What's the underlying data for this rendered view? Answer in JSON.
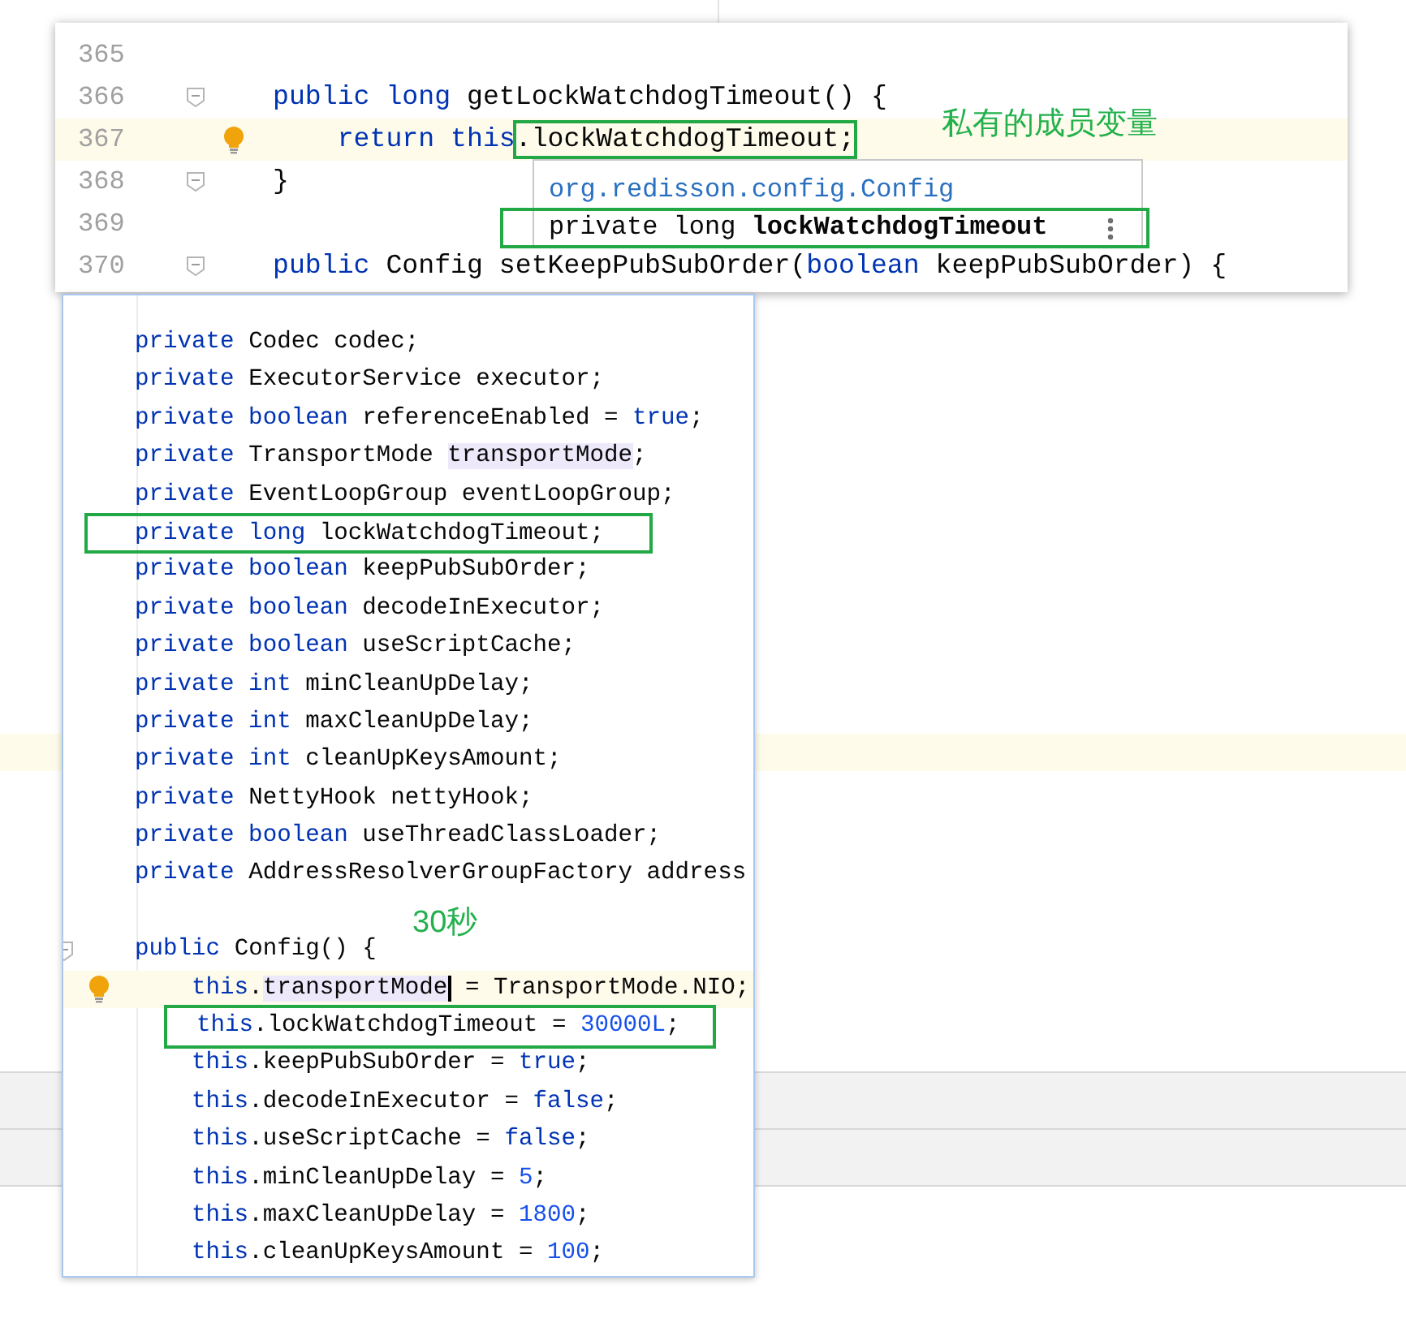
{
  "top_editor": {
    "lines": [
      {
        "number": "365",
        "fold": false,
        "bulb": false,
        "highlighted": false
      },
      {
        "number": "366",
        "fold": true,
        "bulb": false,
        "highlighted": false,
        "tokens": [
          {
            "text": "public long ",
            "kind": "kw"
          },
          {
            "text": "getLockWatchdogTimeout() {",
            "kind": "plain"
          }
        ]
      },
      {
        "number": "367",
        "fold": false,
        "bulb": true,
        "highlighted": true,
        "tokens": [
          {
            "text": "    return this",
            "kind": "kw"
          },
          {
            "text": ".lockWatchdogTimeout;",
            "kind": "plain",
            "boxed": true
          }
        ]
      },
      {
        "number": "368",
        "fold": true,
        "bulb": false,
        "highlighted": false,
        "tokens": [
          {
            "text": "}",
            "kind": "plain"
          }
        ]
      },
      {
        "number": "369",
        "fold": false,
        "bulb": false,
        "highlighted": false
      },
      {
        "number": "370",
        "fold": true,
        "bulb": false,
        "highlighted": false,
        "tokens": [
          {
            "text": "public ",
            "kind": "kw"
          },
          {
            "text": "Config setKeepPubSubOrder(",
            "kind": "plain"
          },
          {
            "text": "boolean ",
            "kind": "kw"
          },
          {
            "text": "keepPubSubOrder) {",
            "kind": "plain"
          }
        ]
      }
    ]
  },
  "hint_popup": {
    "location": "org.redisson.config.Config",
    "signature": "private long **lockWatchdogTimeout**",
    "boxed": true
  },
  "bottom_editor": {
    "lines": [
      {
        "fold": false,
        "bulb": false,
        "highlighted": false,
        "boxed": false,
        "tokens": [
          {
            "text": "private ",
            "kind": "kw"
          },
          {
            "text": "Codec codec;",
            "kind": "plain"
          }
        ]
      },
      {
        "fold": false,
        "bulb": false,
        "highlighted": false,
        "boxed": false,
        "tokens": [
          {
            "text": "private ",
            "kind": "kw"
          },
          {
            "text": "ExecutorService executor;",
            "kind": "plain"
          }
        ]
      },
      {
        "fold": false,
        "bulb": false,
        "highlighted": false,
        "boxed": false,
        "tokens": [
          {
            "text": "private boolean ",
            "kind": "kw"
          },
          {
            "text": "referenceEnabled = ",
            "kind": "plain"
          },
          {
            "text": "true",
            "kind": "kw"
          },
          {
            "text": ";",
            "kind": "plain"
          }
        ]
      },
      {
        "fold": false,
        "bulb": false,
        "highlighted": false,
        "boxed": false,
        "tokens": [
          {
            "text": "private ",
            "kind": "kw"
          },
          {
            "text": "TransportMode ",
            "kind": "plain"
          },
          {
            "text": "transportMode",
            "kind": "plain",
            "marked": true
          },
          {
            "text": ";",
            "kind": "plain"
          }
        ]
      },
      {
        "fold": false,
        "bulb": false,
        "highlighted": false,
        "boxed": false,
        "tokens": [
          {
            "text": "private ",
            "kind": "kw"
          },
          {
            "text": "EventLoopGroup eventLoopGroup;",
            "kind": "plain"
          }
        ]
      },
      {
        "fold": false,
        "bulb": false,
        "highlighted": false,
        "boxed": true,
        "tokens": [
          {
            "text": "private long ",
            "kind": "kw"
          },
          {
            "text": "lockWatchdogTimeout;",
            "kind": "plain"
          }
        ]
      },
      {
        "fold": false,
        "bulb": false,
        "highlighted": false,
        "boxed": false,
        "tokens": [
          {
            "text": "private boolean ",
            "kind": "kw"
          },
          {
            "text": "keepPubSubOrder;",
            "kind": "plain"
          }
        ]
      },
      {
        "fold": false,
        "bulb": false,
        "highlighted": false,
        "boxed": false,
        "tokens": [
          {
            "text": "private boolean ",
            "kind": "kw"
          },
          {
            "text": "decodeInExecutor;",
            "kind": "plain"
          }
        ]
      },
      {
        "fold": false,
        "bulb": false,
        "highlighted": false,
        "boxed": false,
        "tokens": [
          {
            "text": "private boolean ",
            "kind": "kw"
          },
          {
            "text": "useScriptCache;",
            "kind": "plain"
          }
        ]
      },
      {
        "fold": false,
        "bulb": false,
        "highlighted": false,
        "boxed": false,
        "tokens": [
          {
            "text": "private int ",
            "kind": "kw"
          },
          {
            "text": "minCleanUpDelay;",
            "kind": "plain"
          }
        ]
      },
      {
        "fold": false,
        "bulb": false,
        "highlighted": false,
        "boxed": false,
        "tokens": [
          {
            "text": "private int ",
            "kind": "kw"
          },
          {
            "text": "maxCleanUpDelay;",
            "kind": "plain"
          }
        ]
      },
      {
        "fold": false,
        "bulb": false,
        "highlighted": false,
        "boxed": false,
        "tokens": [
          {
            "text": "private int ",
            "kind": "kw"
          },
          {
            "text": "cleanUpKeysAmount;",
            "kind": "plain"
          }
        ]
      },
      {
        "fold": false,
        "bulb": false,
        "highlighted": false,
        "boxed": false,
        "tokens": [
          {
            "text": "private ",
            "kind": "kw"
          },
          {
            "text": "NettyHook nettyHook;",
            "kind": "plain"
          }
        ]
      },
      {
        "fold": false,
        "bulb": false,
        "highlighted": false,
        "boxed": false,
        "tokens": [
          {
            "text": "private boolean ",
            "kind": "kw"
          },
          {
            "text": "useThreadClassLoader;",
            "kind": "plain"
          }
        ]
      },
      {
        "fold": false,
        "bulb": false,
        "highlighted": false,
        "boxed": false,
        "tokens": [
          {
            "text": "private ",
            "kind": "kw"
          },
          {
            "text": "AddressResolverGroupFactory address",
            "kind": "plain"
          }
        ]
      },
      {
        "fold": false,
        "bulb": false,
        "highlighted": false
      },
      {
        "fold": true,
        "bulb": false,
        "highlighted": false,
        "boxed": false,
        "tokens": [
          {
            "text": "public ",
            "kind": "kw"
          },
          {
            "text": "Config() {",
            "kind": "plain"
          }
        ]
      },
      {
        "fold": false,
        "bulb": true,
        "highlighted": true,
        "boxed": false,
        "tokens": [
          {
            "text": "    this",
            "kind": "kw"
          },
          {
            "text": ".",
            "kind": "plain"
          },
          {
            "text": "transportMode",
            "kind": "plain",
            "marked": true,
            "caret": true
          },
          {
            "text": " = TransportMode.NIO;",
            "kind": "plain"
          }
        ]
      },
      {
        "fold": false,
        "bulb": false,
        "highlighted": false,
        "boxed": true,
        "tokens": [
          {
            "text": "    this",
            "kind": "kw"
          },
          {
            "text": ".lockWatchdogTimeout = ",
            "kind": "plain"
          },
          {
            "text": "30000L",
            "kind": "num"
          },
          {
            "text": ";",
            "kind": "plain"
          }
        ]
      },
      {
        "fold": false,
        "bulb": false,
        "highlighted": false,
        "boxed": false,
        "tokens": [
          {
            "text": "    this",
            "kind": "kw"
          },
          {
            "text": ".keepPubSubOrder = ",
            "kind": "plain"
          },
          {
            "text": "true",
            "kind": "kw"
          },
          {
            "text": ";",
            "kind": "plain"
          }
        ]
      },
      {
        "fold": false,
        "bulb": false,
        "highlighted": false,
        "boxed": false,
        "tokens": [
          {
            "text": "    this",
            "kind": "kw"
          },
          {
            "text": ".decodeInExecutor = ",
            "kind": "plain"
          },
          {
            "text": "false",
            "kind": "kw"
          },
          {
            "text": ";",
            "kind": "plain"
          }
        ]
      },
      {
        "fold": false,
        "bulb": false,
        "highlighted": false,
        "boxed": false,
        "tokens": [
          {
            "text": "    this",
            "kind": "kw"
          },
          {
            "text": ".useScriptCache = ",
            "kind": "plain"
          },
          {
            "text": "false",
            "kind": "kw"
          },
          {
            "text": ";",
            "kind": "plain"
          }
        ]
      },
      {
        "fold": false,
        "bulb": false,
        "highlighted": false,
        "boxed": false,
        "tokens": [
          {
            "text": "    this",
            "kind": "kw"
          },
          {
            "text": ".minCleanUpDelay = ",
            "kind": "plain"
          },
          {
            "text": "5",
            "kind": "num"
          },
          {
            "text": ";",
            "kind": "plain"
          }
        ]
      },
      {
        "fold": false,
        "bulb": false,
        "highlighted": false,
        "boxed": false,
        "tokens": [
          {
            "text": "    this",
            "kind": "kw"
          },
          {
            "text": ".maxCleanUpDelay = ",
            "kind": "plain"
          },
          {
            "text": "1800",
            "kind": "num"
          },
          {
            "text": ";",
            "kind": "plain"
          }
        ]
      },
      {
        "fold": false,
        "bulb": false,
        "highlighted": false,
        "boxed": false,
        "tokens": [
          {
            "text": "    this",
            "kind": "kw"
          },
          {
            "text": ".cleanUpKeysAmount = ",
            "kind": "plain"
          },
          {
            "text": "100",
            "kind": "num"
          },
          {
            "text": ";",
            "kind": "plain"
          }
        ]
      }
    ]
  },
  "annotations": [
    {
      "text": "私有的成员变量"
    },
    {
      "text": "30秒"
    }
  ]
}
